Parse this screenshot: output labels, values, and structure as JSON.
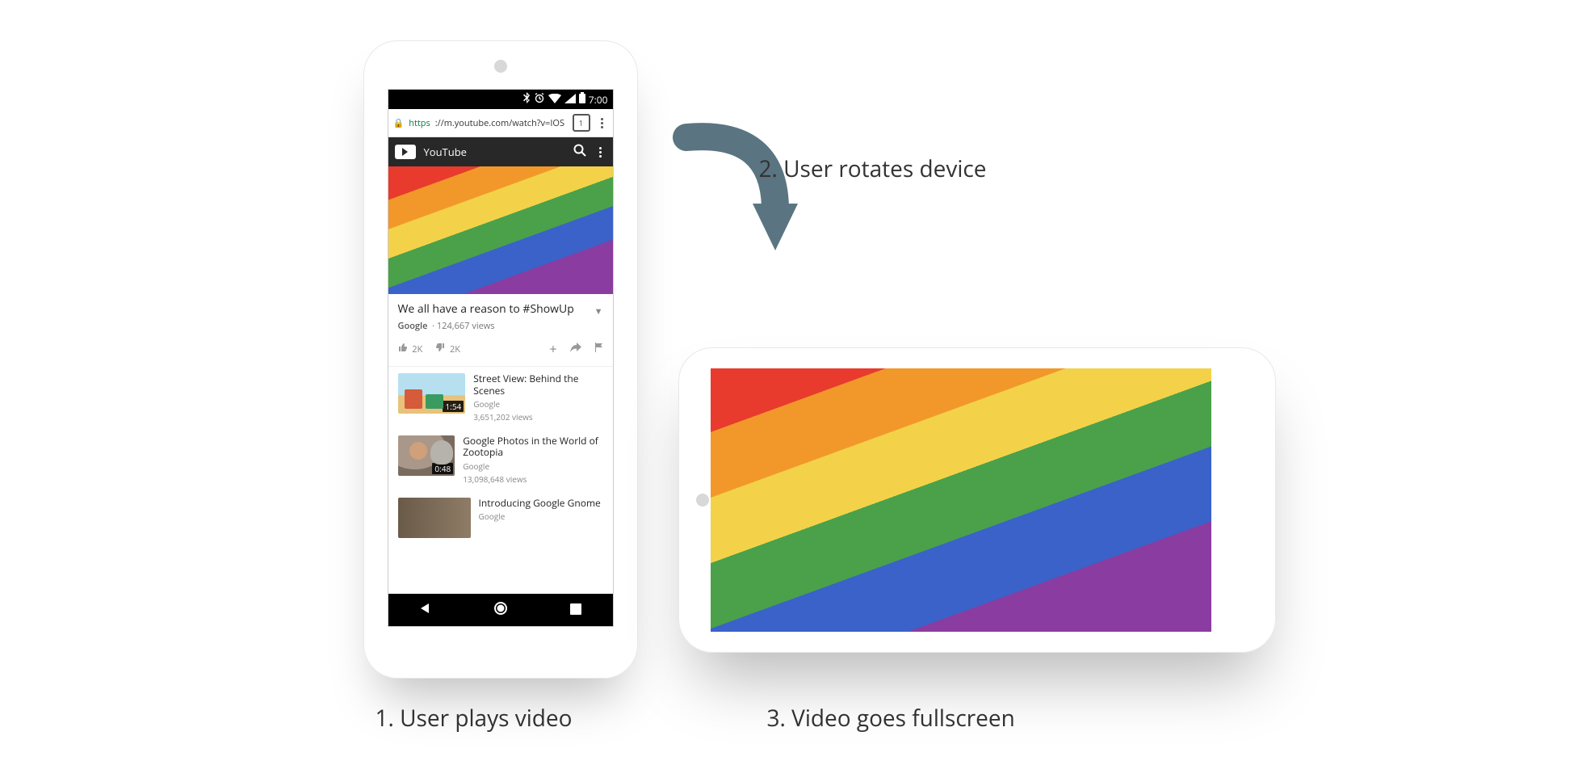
{
  "captions": {
    "c1": "1. User plays video",
    "c2": "2. User rotates device",
    "c3": "3. Video goes fullscreen"
  },
  "status": {
    "time": "7:00",
    "icons": {
      "bt": "bluetooth-icon",
      "alarm": "alarm-icon",
      "wifi": "wifi-icon",
      "cell": "cell-signal-icon",
      "batt": "battery-icon"
    }
  },
  "chrome": {
    "lock": "🔒",
    "https": "https",
    "url_rest": "://m.youtube.com/watch?v=IOS",
    "tabs": "1"
  },
  "yt": {
    "name": "YouTube"
  },
  "video": {
    "title": "We all have a reason to #ShowUp",
    "channel": "Google",
    "views": "124,667 views",
    "likes": "2K",
    "dislikes": "2K"
  },
  "suggested": [
    {
      "title": "Street View: Behind the Scenes",
      "channel": "Google",
      "views": "3,651,202 views",
      "dur": "1:54"
    },
    {
      "title": "Google Photos in the World of Zootopia",
      "channel": "Google",
      "views": "13,098,648 views",
      "dur": "0:48"
    },
    {
      "title": "Introducing Google Gnome",
      "channel": "Google",
      "views": "",
      "dur": ""
    }
  ]
}
